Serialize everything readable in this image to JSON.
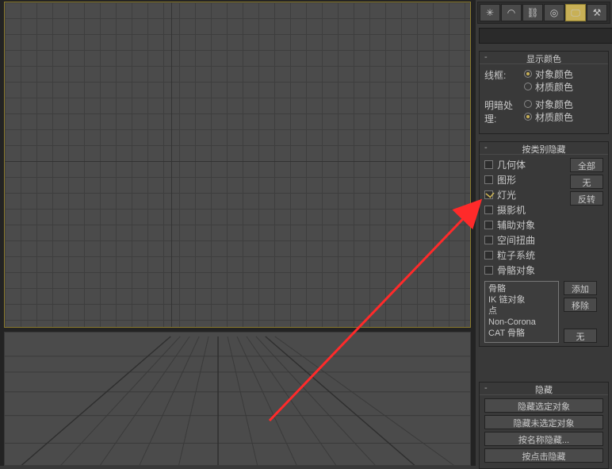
{
  "panel_tabs": {
    "icons": [
      "create-icon",
      "modify-icon",
      "hierarchy-icon",
      "motion-icon",
      "display-icon",
      "utilities-icon"
    ],
    "active_index": 4
  },
  "name_field": {
    "value": ""
  },
  "display_color": {
    "title": "显示颜色",
    "wireframe_label": "线框:",
    "shaded_label": "明暗处理:",
    "wireframe": {
      "object_color": "对象颜色",
      "material_color": "材质颜色",
      "selected": "object_color"
    },
    "shaded": {
      "object_color": "对象颜色",
      "material_color": "材质颜色",
      "selected": "material_color"
    }
  },
  "hide_by_category": {
    "title": "按类别隐藏",
    "categories": [
      {
        "key": "geometry",
        "label": "几何体",
        "checked": false
      },
      {
        "key": "shapes",
        "label": "图形",
        "checked": false
      },
      {
        "key": "lights",
        "label": "灯光",
        "checked": true
      },
      {
        "key": "cameras",
        "label": "摄影机",
        "checked": false
      },
      {
        "key": "helpers",
        "label": "辅助对象",
        "checked": false
      },
      {
        "key": "spacewarps",
        "label": "空间扭曲",
        "checked": false
      },
      {
        "key": "particles",
        "label": "粒子系统",
        "checked": false
      },
      {
        "key": "bone_obj",
        "label": "骨骼对象",
        "checked": false
      }
    ],
    "buttons": {
      "all": "全部",
      "none": "无",
      "invert": "反转"
    },
    "list": [
      "骨骼",
      "IK 链对象",
      "点",
      "Non-Corona",
      "CAT 骨骼"
    ],
    "list_buttons": {
      "add": "添加",
      "remove": "移除",
      "none": "无"
    }
  },
  "hide_rollout": {
    "title": "隐藏",
    "buttons": [
      "隐藏选定对象",
      "隐藏未选定对象",
      "按名称隐藏...",
      "按点击隐藏"
    ]
  },
  "colors": {
    "accent": "#c8b056",
    "arrow": "#ff2a2a"
  }
}
